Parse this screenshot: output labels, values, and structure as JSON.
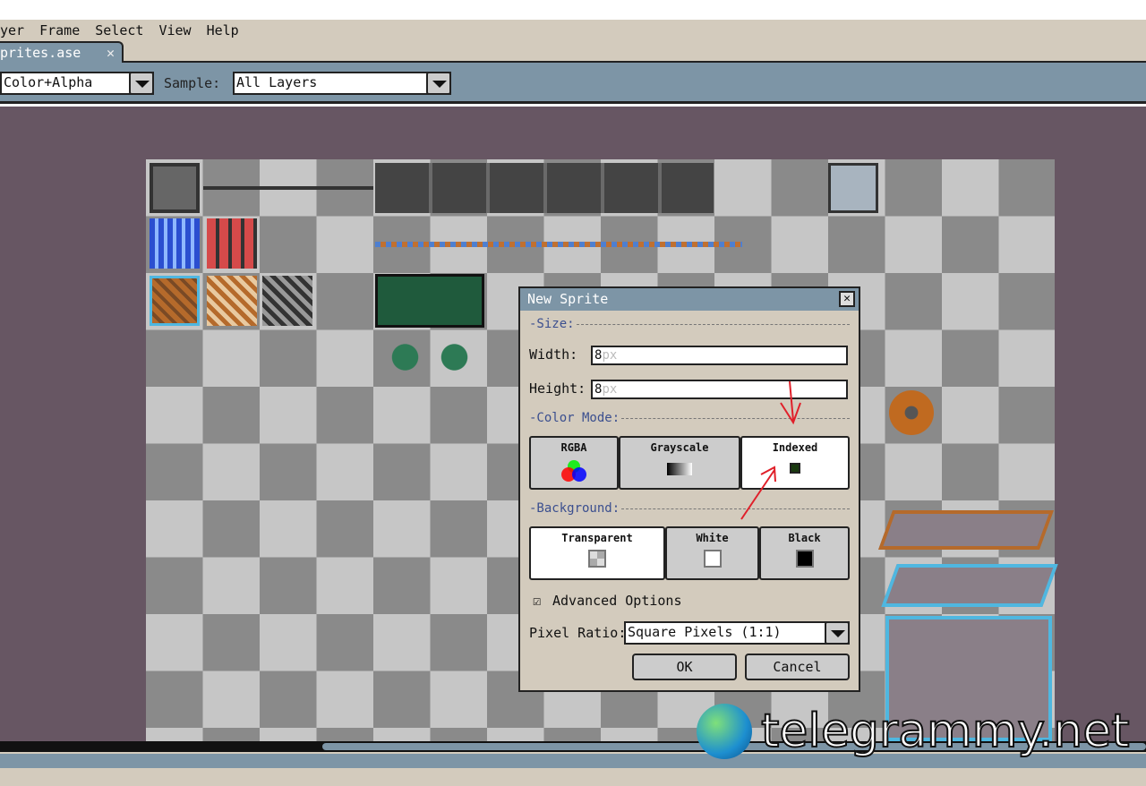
{
  "menu": [
    "yer",
    "Frame",
    "Select",
    "View",
    "Help"
  ],
  "tab": {
    "label": "prites.ase",
    "close": "✕"
  },
  "toolbar": {
    "mode_value": "Color+Alpha",
    "sample_label": "Sample:",
    "sample_value": "All Layers"
  },
  "dialog": {
    "title": "New Sprite",
    "close": "✕",
    "size_section": "-Size:",
    "width_label": "Width:",
    "width_value": "8",
    "width_unit": "px",
    "height_label": "Height:",
    "height_value": "8",
    "height_unit": "px",
    "color_mode_section": "-Color Mode:",
    "color_modes": [
      {
        "label": "RGBA",
        "selected": false
      },
      {
        "label": "Grayscale",
        "selected": false
      },
      {
        "label": "Indexed",
        "selected": true
      }
    ],
    "background_section": "-Background:",
    "backgrounds": [
      {
        "label": "Transparent",
        "selected": true
      },
      {
        "label": "White",
        "selected": false
      },
      {
        "label": "Black",
        "selected": false
      }
    ],
    "advanced_label": "Advanced Options",
    "advanced_checked": true,
    "pixel_ratio_label": "Pixel Ratio:",
    "pixel_ratio_value": "Square Pixels (1:1)",
    "ok": "OK",
    "cancel": "Cancel"
  },
  "watermark": "telegrammy.net",
  "colors": {
    "accent": "#7d95a6",
    "workspace": "#675663",
    "dialog": "#d3cbbd",
    "section": "#3b4f8f",
    "annotation": "#e0202a"
  }
}
